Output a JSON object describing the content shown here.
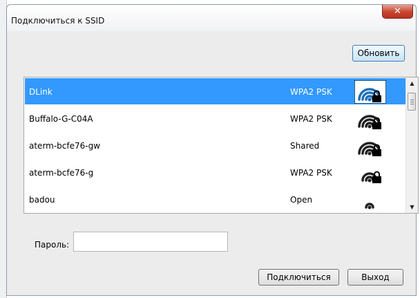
{
  "window": {
    "title": "Подключиться к SSID",
    "close_label": "✕"
  },
  "toolbar": {
    "refresh_label": "Обновить"
  },
  "networks": [
    {
      "ssid": "DLink",
      "security": "WPA2 PSK",
      "signal_bars": 3,
      "locked": true,
      "selected": true
    },
    {
      "ssid": "Buffalo-G-C04A",
      "security": "WPA2 PSK",
      "signal_bars": 3,
      "locked": true,
      "selected": false
    },
    {
      "ssid": "aterm-bcfe76-gw",
      "security": "Shared",
      "signal_bars": 3,
      "locked": true,
      "selected": false
    },
    {
      "ssid": "aterm-bcfe76-g",
      "security": "WPA2 PSK",
      "signal_bars": 2,
      "locked": true,
      "selected": false
    },
    {
      "ssid": "badou",
      "security": "Open",
      "signal_bars": 1,
      "locked": false,
      "selected": false
    }
  ],
  "password": {
    "label": "Пароль:",
    "value": ""
  },
  "buttons": {
    "connect_label": "Подключиться",
    "exit_label": "Выход"
  },
  "colors": {
    "selection": "#3399ff",
    "selected_icon": "#1e6fb8",
    "icon": "#222222",
    "close_button": "#c8442f"
  }
}
